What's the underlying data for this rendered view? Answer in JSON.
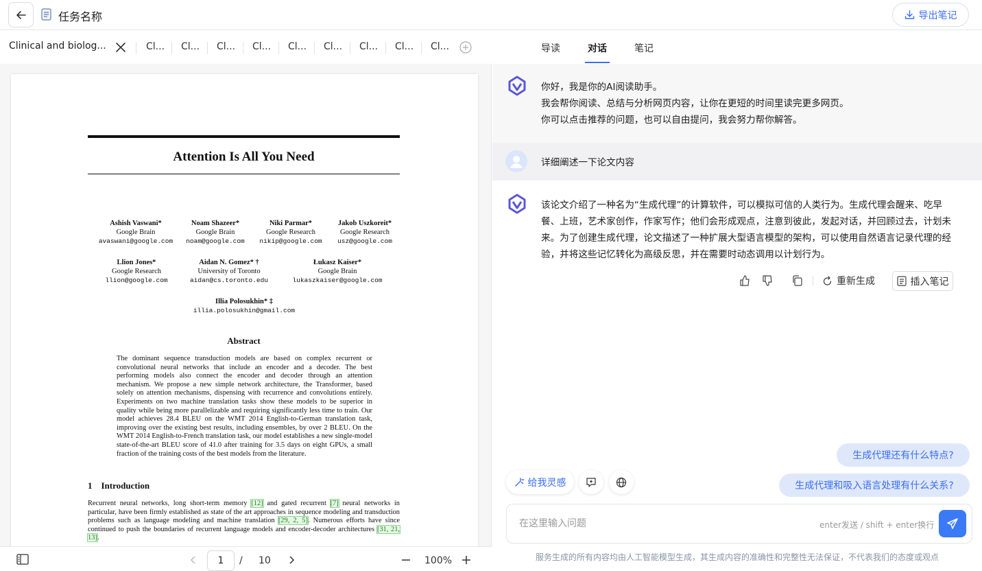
{
  "header": {
    "task_title": "任务名称",
    "export_label": "导出笔记"
  },
  "doc_tabs": {
    "active_label": "Clinical and biolog...",
    "mini_labels": [
      "Cl...",
      "Cl...",
      "Cl...",
      "Cl...",
      "Cl...",
      "Cl...",
      "Cl...",
      "Cl...",
      "Cl..."
    ]
  },
  "paper": {
    "title": "Attention Is All You Need",
    "authors": [
      {
        "name": "Ashish Vaswani*",
        "affil": "Google Brain",
        "email": "avaswani@google.com"
      },
      {
        "name": "Noam Shazeer*",
        "affil": "Google Brain",
        "email": "noam@google.com"
      },
      {
        "name": "Niki Parmar*",
        "affil": "Google Research",
        "email": "nikip@google.com"
      },
      {
        "name": "Jakob Uszkoreit*",
        "affil": "Google Research",
        "email": "usz@google.com"
      },
      {
        "name": "Llion Jones*",
        "affil": "Google Research",
        "email": "llion@google.com"
      },
      {
        "name": "Aidan N. Gomez* †",
        "affil": "University of Toronto",
        "email": "aidan@cs.toronto.edu"
      },
      {
        "name": "Łukasz Kaiser*",
        "affil": "Google Brain",
        "email": "lukaszkaiser@google.com"
      },
      {
        "name": "Illia Polosukhin* ‡",
        "affil": "",
        "email": "illia.polosukhin@gmail.com"
      }
    ],
    "abstract_title": "Abstract",
    "abstract": "The dominant sequence transduction models are based on complex recurrent or convolutional neural networks that include an encoder and a decoder. The best performing models also connect the encoder and decoder through an attention mechanism. We propose a new simple network architecture, the Transformer, based solely on attention mechanisms, dispensing with recurrence and convolutions entirely. Experiments on two machine translation tasks show these models to be superior in quality while being more parallelizable and requiring significantly less time to train. Our model achieves 28.4 BLEU on the WMT 2014 English-to-German translation task, improving over the existing best results, including ensembles, by over 2 BLEU. On the WMT 2014 English-to-French translation task, our model establishes a new single-model state-of-the-art BLEU score of 41.0 after training for 3.5 days on eight GPUs, a small fraction of the training costs of the best models from the literature.",
    "section_title": "1    Introduction",
    "intro_parts": {
      "p1": "Recurrent neural networks, long short-term memory ",
      "c1": "[12]",
      "p2": " and gated recurrent ",
      "c2": "[7]",
      "p3": " neural networks in particular, have been firmly established as state of the art approaches in sequence modeling and transduction problems such as language modeling and machine translation ",
      "c3": "[29, 2, 5]",
      "p4": ". Numerous efforts have since continued to push the boundaries of recurrent language models and encoder-decoder architectures ",
      "c4": "[31, 21, 13]",
      "p5": "."
    }
  },
  "pdf_toolbar": {
    "current_page": "1",
    "separator": "/",
    "total_pages": "10",
    "zoom": "100%"
  },
  "right_tabs": [
    "导读",
    "对话",
    "笔记"
  ],
  "chat": {
    "greeting": [
      "你好，我是你的AI阅读助手。",
      "我会帮你阅读、总结与分析网页内容，让你在更短的时间里读完更多网页。",
      "你可以点击推荐的问题，也可以自由提问，我会努力帮你解答。"
    ],
    "user_message": "详细阐述一下论文内容",
    "answer": "该论文介绍了一种名为“生成代理”的计算软件，可以模拟可信的人类行为。生成代理会醒来、吃早餐、上班，艺术家创作，作家写作；他们会形成观点，注意到彼此，发起对话，并回顾过去，计划未来。为了创建生成代理，论文描述了一种扩展大型语言模型的架构，可以使用自然语言记录代理的经验，并将这些记忆转化为高级反思，并在需要时动态调用以计划行为。",
    "regenerate_label": "重新生成",
    "insert_note_label": "插入笔记"
  },
  "suggestions": [
    "生成代理还有什么特点?",
    "生成代理和吸入语言处理有什么关系?"
  ],
  "tools": {
    "inspire_label": "给我灵感"
  },
  "input": {
    "placeholder": "在这里输入问题",
    "hint": "enter发送 / shift + enter换行"
  },
  "disclaimer": "服务生成的所有内容均由人工智能模型生成，其生成内容的准确性和完整性无法保证，不代表我们的态度或观点",
  "colors": {
    "accent": "#3b6ef2",
    "suggestion_bg": "#dfe8fb",
    "send_bg": "#3b7af7"
  }
}
